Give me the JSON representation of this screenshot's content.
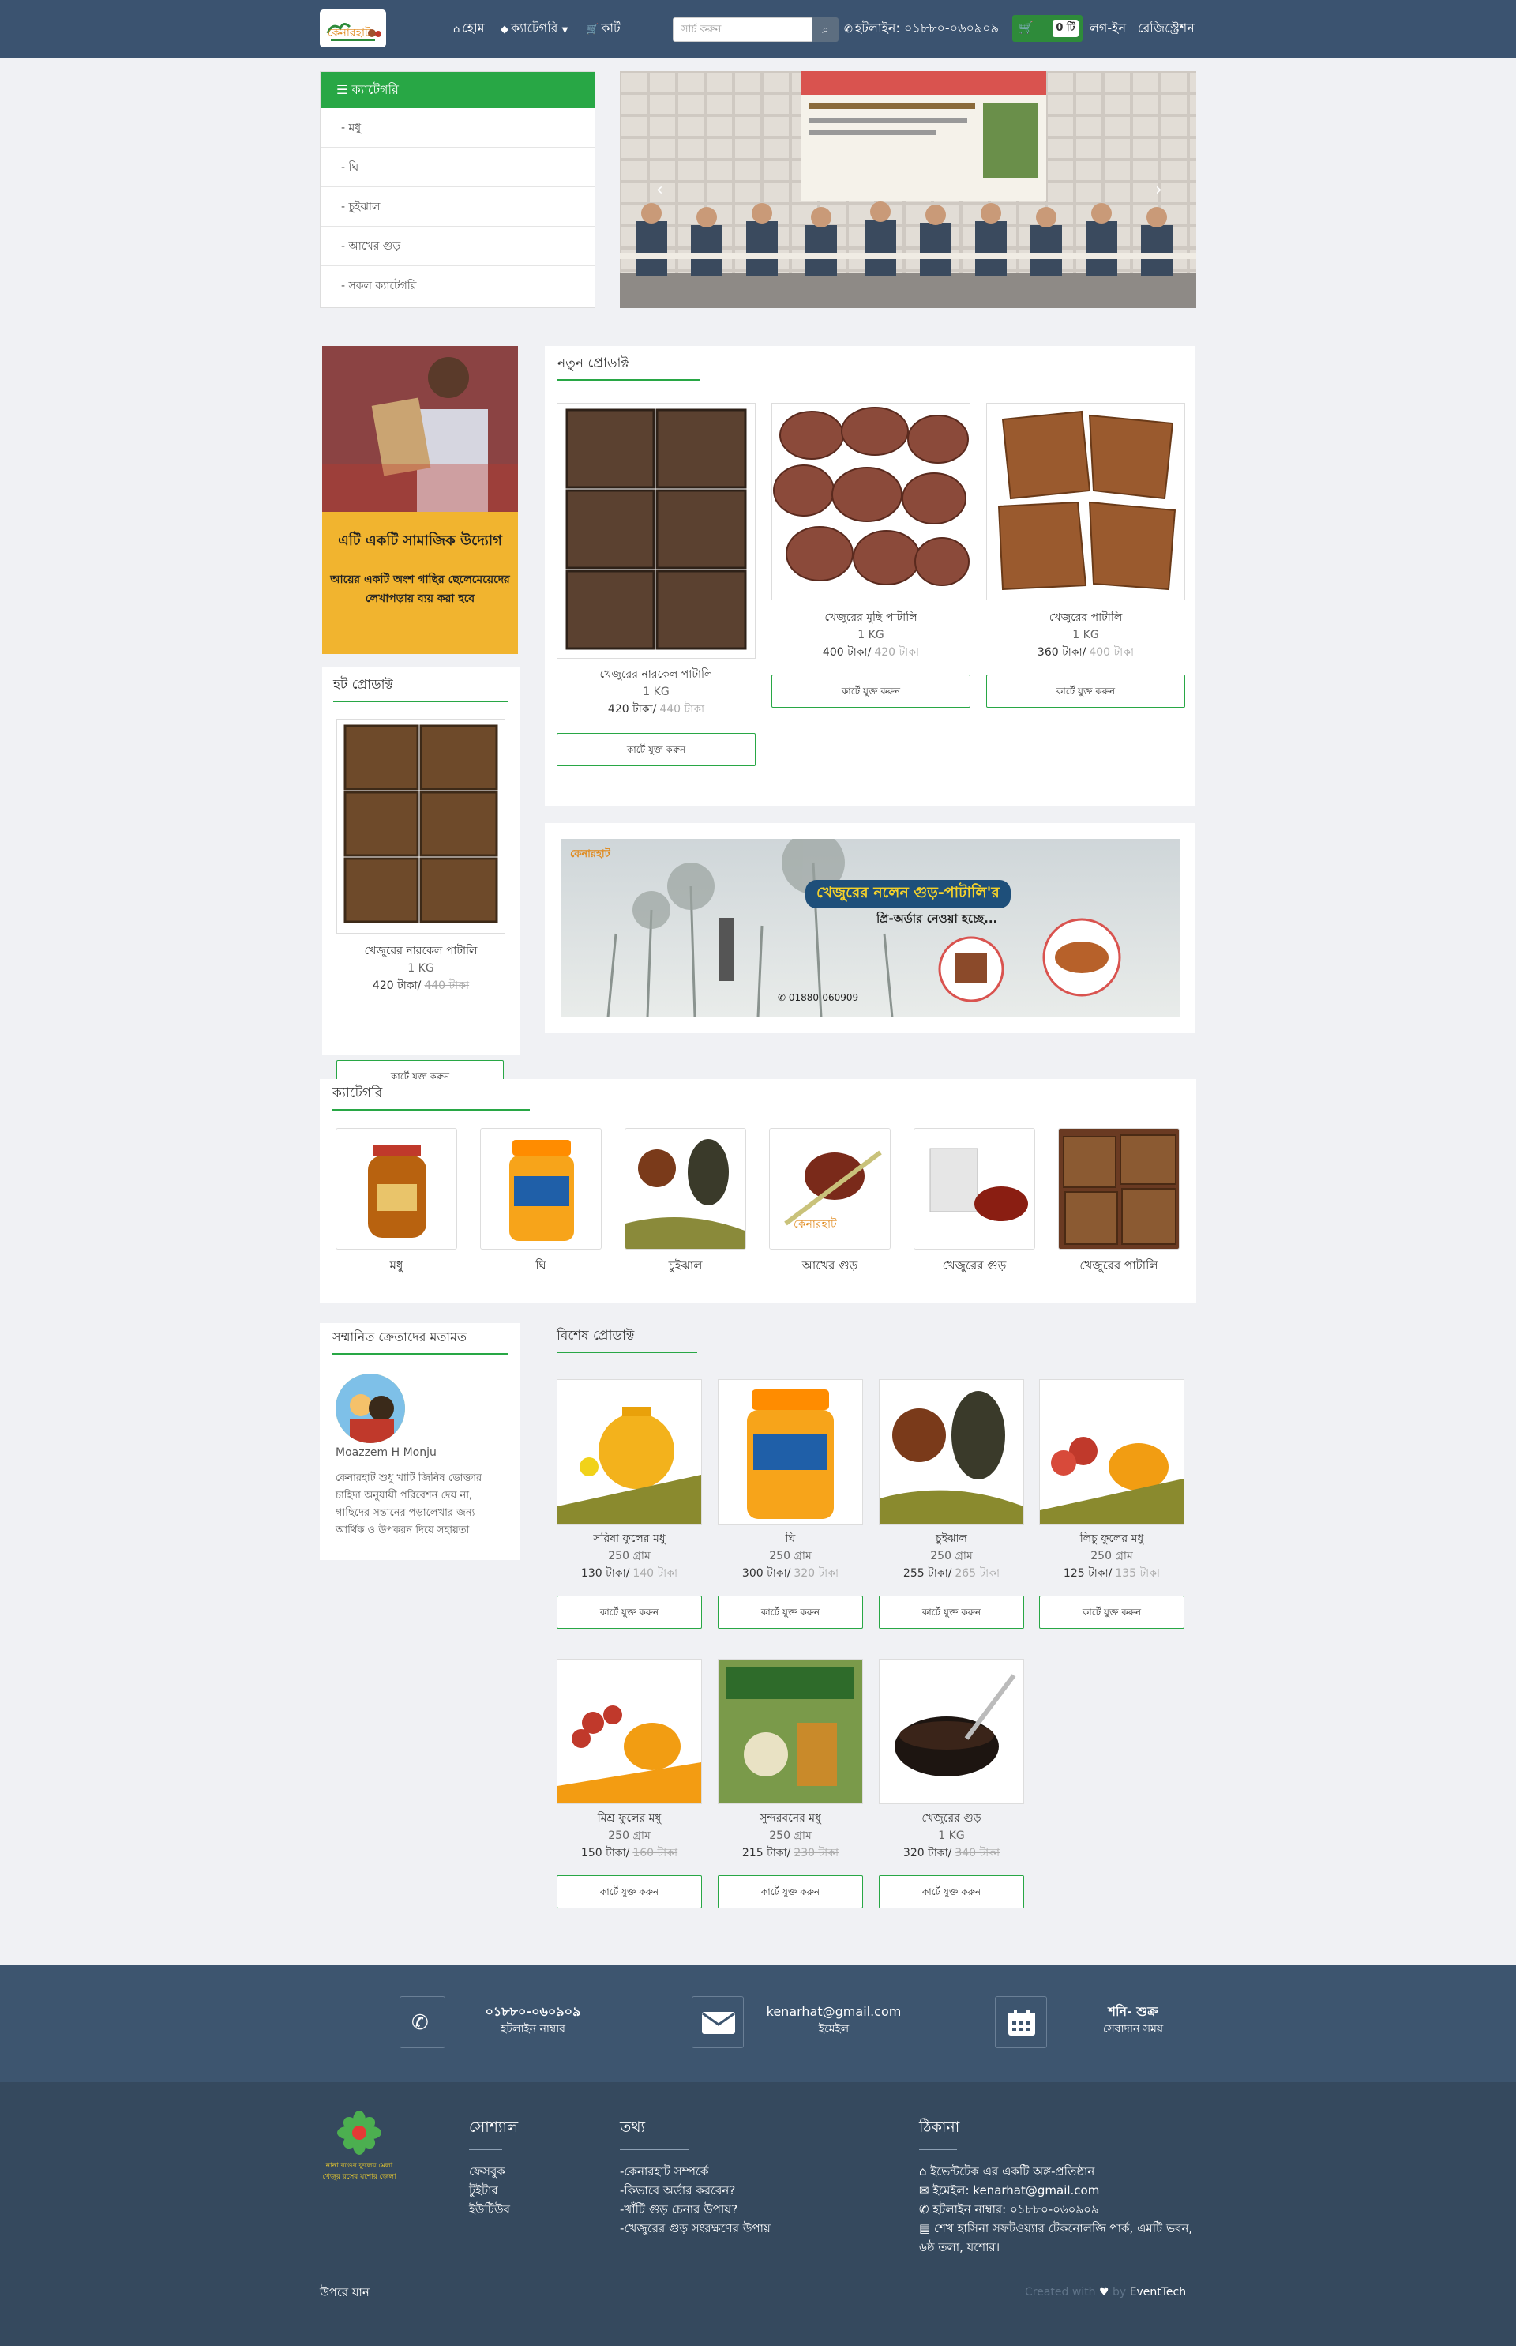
{
  "nav": {
    "home": "হোম",
    "category": "ক্যাটেগরি",
    "cart": "কার্ট",
    "search_placeholder": "সার্চ করুন",
    "hotline": "হটলাইন: ০১৮৮০-০৬০৯০৯",
    "cart_count": "0 টি",
    "login": "লগ-ইন",
    "register": "রেজিস্ট্রেশন"
  },
  "sidebar": {
    "title": "ক্যাটেগরি",
    "items": [
      "- মধু",
      "- ঘি",
      "- চুইঝাল",
      "- আখের গুড়",
      "- সকল ক্যাটেগরি"
    ]
  },
  "slider": {
    "banner_text": "খেজুর গাছিদের প্রশিক্ষণ ও উপকরণ বিতরণ অনুষ্ঠান"
  },
  "promo": {
    "heading": "এটি একটি সামাজিক উদ্যোগ",
    "body": "আয়ের একটি অংশ গাছির ছেলেমেয়েদের লেখাপড়ায় ব্যয় করা হবে"
  },
  "hot": {
    "title": "হট প্রোডাক্ট",
    "product": {
      "name": "খেজুরের নারকেল পাটালি",
      "weight": "1 KG",
      "price": "420 টাকা/",
      "old_price": "440 টাকা",
      "button": "কার্টে যুক্ত করুন"
    }
  },
  "new_products": {
    "title": "নতুন প্রোডাক্ট",
    "items": [
      {
        "name": "খেজুরের নারকেল পাটালি",
        "weight": "1 KG",
        "price": "420 টাকা/",
        "old_price": "440 টাকা",
        "button": "কার্টে যুক্ত করুন"
      },
      {
        "name": "খেজুরের মুছি পাটালি",
        "weight": "1 KG",
        "price": "400 টাকা/",
        "old_price": "420 টাকা",
        "button": "কার্টে যুক্ত করুন"
      },
      {
        "name": "খেজুরের পাটালি",
        "weight": "1 KG",
        "price": "360 টাকা/",
        "old_price": "400 টাকা",
        "button": "কার্টে যুক্ত করুন"
      }
    ]
  },
  "banner2": {
    "logo": "কেনারহাট",
    "headline": "খেজুরের নলেন গুড়-পাটালি'র",
    "sub": "প্রি-অর্ডার নেওয়া হচ্ছে...",
    "phone": "01880-060909"
  },
  "categories": {
    "title": "ক্যাটেগরি",
    "items": [
      "মধু",
      "ঘি",
      "চুইঝাল",
      "আখের গুড়",
      "খেজুরের গুড়",
      "খেজুরের পাটালি"
    ]
  },
  "testimonial": {
    "title": "সম্মানিত ক্রেতাদের মতামত",
    "name": "Moazzem H Monju",
    "text": "কেনারহাট শুধু খাটি জিনিষ ভোক্তার চাহিদা অনুযায়ী পরিবেশন দেয় না, গাছিদের সন্তানের পড়ালেখার জন্য আর্থিক ও উপকরন দিয়ে সহায়তা"
  },
  "special": {
    "title": "বিশেষ প্রোডাক্ট",
    "items": [
      {
        "name": "সরিষা ফুলের মধু",
        "weight": "250 গ্রাম",
        "price": "130 টাকা/",
        "old_price": "140 টাকা",
        "button": "কার্টে যুক্ত করুন"
      },
      {
        "name": "ঘি",
        "weight": "250 গ্রাম",
        "price": "300 টাকা/",
        "old_price": "320 টাকা",
        "button": "কার্টে যুক্ত করুন"
      },
      {
        "name": "চুইঝাল",
        "weight": "250 গ্রাম",
        "price": "255 টাকা/",
        "old_price": "265 টাকা",
        "button": "কার্টে যুক্ত করুন"
      },
      {
        "name": "লিচু ফুলের মধু",
        "weight": "250 গ্রাম",
        "price": "125 টাকা/",
        "old_price": "135 টাকা",
        "button": "কার্টে যুক্ত করুন"
      },
      {
        "name": "মিশ্র ফুলের মধু",
        "weight": "250 গ্রাম",
        "price": "150 টাকা/",
        "old_price": "160 টাকা",
        "button": "কার্টে যুক্ত করুন"
      },
      {
        "name": "সুন্দরবনের মধু",
        "weight": "250 গ্রাম",
        "price": "215 টাকা/",
        "old_price": "230 টাকা",
        "button": "কার্টে যুক্ত করুন"
      },
      {
        "name": "খেজুরের গুড়",
        "weight": "1 KG",
        "price": "320 টাকা/",
        "old_price": "340 টাকা",
        "button": "কার্টে যুক্ত করুন"
      }
    ]
  },
  "contact": {
    "phone": "০১৮৮০-০৬০৯০৯",
    "phone_label": "হটলাইন নাম্বার",
    "email": "kenarhat@gmail.com",
    "email_label": "ইমেইল",
    "days": "শনি- শুক্র",
    "days_label": "সেবাদান সময়"
  },
  "footer": {
    "logo_line1": "নানা রঙের ফুলের মেলা",
    "logo_line2": "খেজুর রসের যশোর জেলা",
    "social_title": "সোশ্যাল",
    "social": [
      "ফেসবুক",
      "টুইটার",
      "ইউটিউব"
    ],
    "info_title": "তথ্য",
    "info": [
      "-কেনারহাট সম্পর্কে",
      "-কিভাবে অর্ডার করবেন?",
      "-খাঁটি গুড় চেনার উপায়?",
      "-খেজুরের গুড় সংরক্ষণের উপায়"
    ],
    "address_title": "ঠিকানা",
    "address": [
      "ইভেন্টটেক এর একটি অঙ্গ-প্রতিষ্ঠান",
      "ইমেইল: kenarhat@gmail.com",
      "হটলাইন নাম্বার: ০১৮৮০-০৬০৯০৯",
      "শেখ হাসিনা সফটওয়্যার টেকনোলজি পার্ক, এমটি ভবন,",
      "৬ষ্ঠ তলা, যশোর।"
    ],
    "back_to_top": "উপরে যান",
    "credit_prefix": "Created with",
    "credit_by": "by",
    "credit_name": "EventTech"
  },
  "colors": {
    "nav": "#3b5370",
    "accent": "#28a745",
    "footer": "#35495e",
    "contact": "#3d556f",
    "promo": "#f1b42f"
  }
}
